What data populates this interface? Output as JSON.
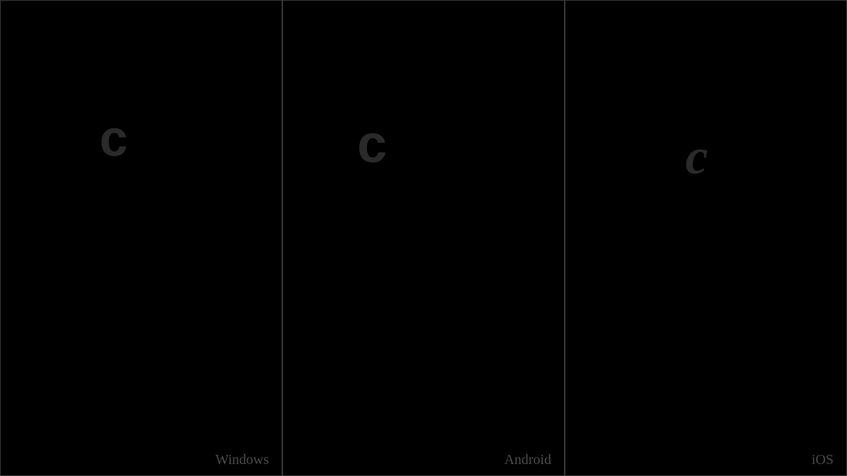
{
  "panels": [
    {
      "glyph": "c",
      "label": "Windows"
    },
    {
      "glyph": "c",
      "label": "Android"
    },
    {
      "glyph": "c",
      "label": "iOS"
    }
  ]
}
